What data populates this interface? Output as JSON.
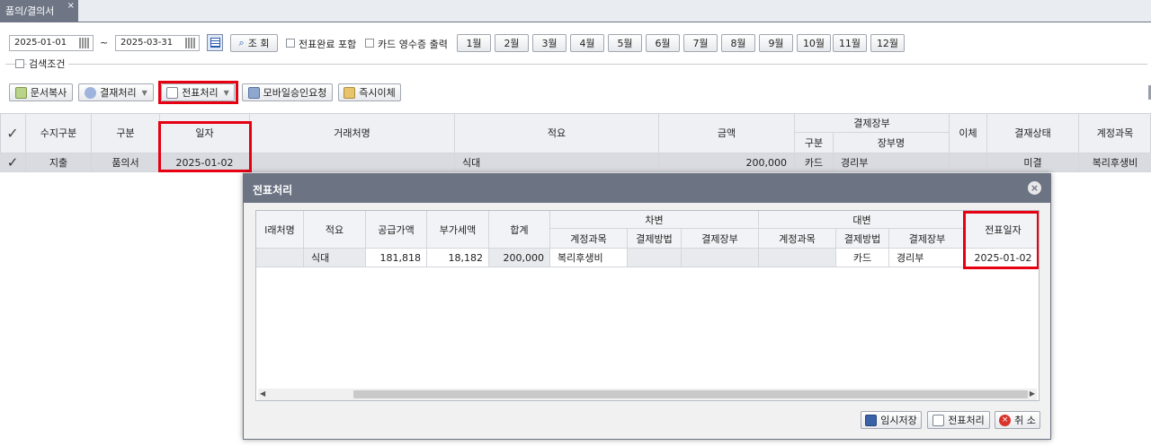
{
  "tab": {
    "label": "품의/결의서",
    "close": "×"
  },
  "filters": {
    "date_from": "2025-01-01",
    "tilde": "~",
    "date_to": "2025-03-31",
    "search_btn": "조 회",
    "chk_slip_done": "전표완료 포함",
    "chk_card_receipt": "카드 영수증 출력",
    "months": [
      "1월",
      "2월",
      "3월",
      "4월",
      "5월",
      "6월",
      "7월",
      "8월",
      "9월",
      "10월",
      "11월",
      "12월"
    ],
    "search_cond": "검색조건"
  },
  "toolbar": {
    "copy_doc": "문서복사",
    "approve": "결재처리",
    "slip": "전표처리",
    "mobile": "모바일승인요청",
    "transfer": "즉시이체"
  },
  "grid": {
    "headers": {
      "type_in_out": "수지구분",
      "kind": "구분",
      "date": "일자",
      "vendor": "거래처명",
      "memo": "적요",
      "amount": "금액",
      "pay_ledger": "결제장부",
      "pay_kind": "구분",
      "ledger_name": "장부명",
      "transfer": "이체",
      "status": "결재상태",
      "account": "계정과목"
    },
    "row": {
      "type_in_out": "지출",
      "kind": "품의서",
      "date": "2025-01-02",
      "vendor": "",
      "memo": "식대",
      "amount": "200,000",
      "pay_kind": "카드",
      "ledger_name": "경리부",
      "transfer": "",
      "status": "미결",
      "account": "복리후생비"
    }
  },
  "dialog": {
    "title": "전표처리",
    "close": "×",
    "headers": {
      "vendor": "l래처명",
      "memo": "적요",
      "supply": "공급가액",
      "vat": "부가세액",
      "total": "합계",
      "debit": "차변",
      "credit": "대변",
      "d_account": "계정과목",
      "d_method": "결제방법",
      "d_ledger": "결제장부",
      "c_account": "계정과목",
      "c_method": "결제방법",
      "c_ledger": "결제장부",
      "slip_date": "전표일자"
    },
    "row": {
      "vendor": "",
      "memo": "식대",
      "supply": "181,818",
      "vat": "18,182",
      "total": "200,000",
      "d_account": "복리후생비",
      "d_method": "",
      "d_ledger": "",
      "c_account": "",
      "c_method": "카드",
      "c_ledger": "경리부",
      "slip_date": "2025-01-02"
    },
    "buttons": {
      "temp_save": "임시저장",
      "slip": "전표처리",
      "cancel": "취 소"
    }
  }
}
